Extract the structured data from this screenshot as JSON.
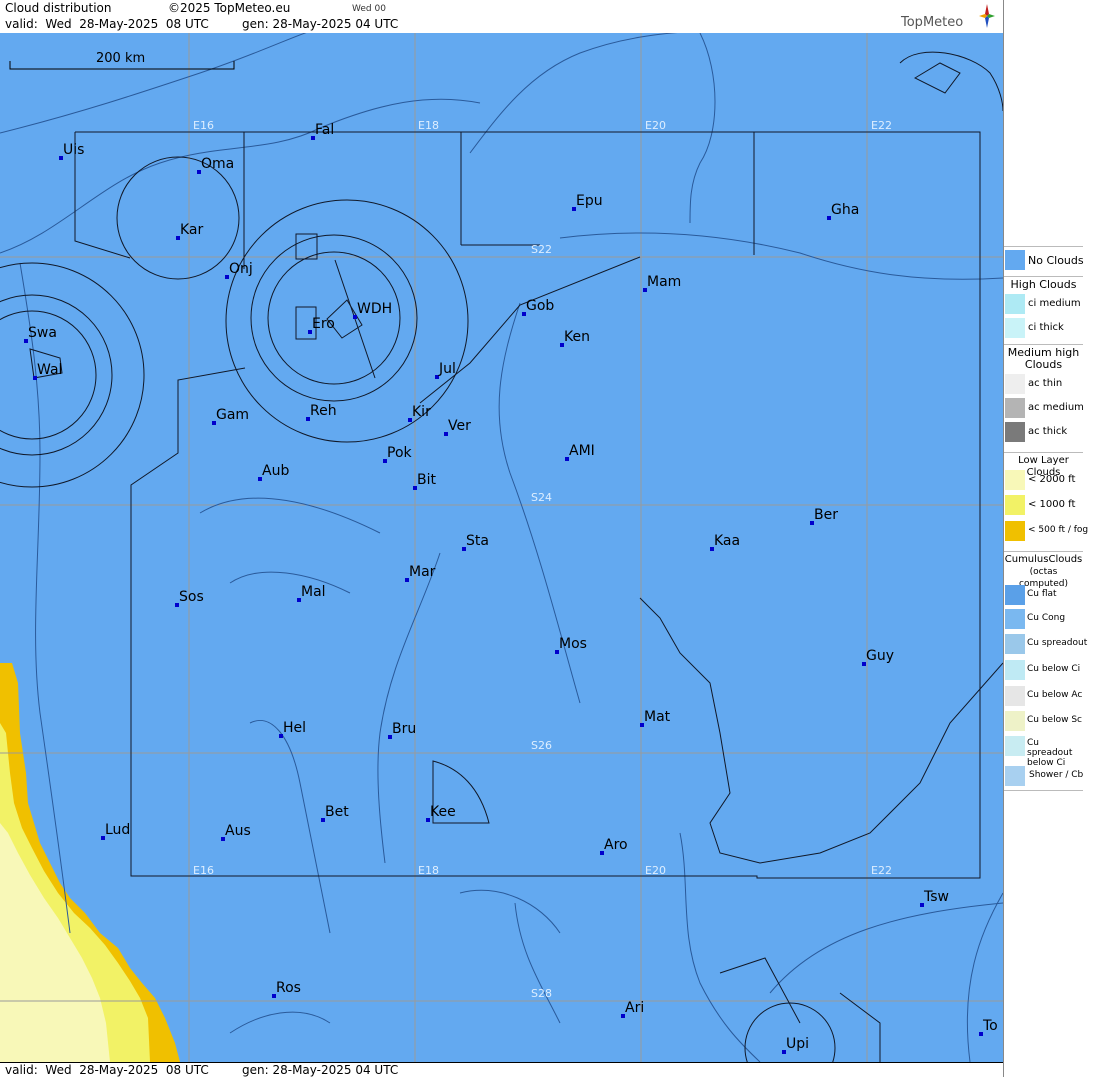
{
  "header": {
    "title": "Cloud distribution",
    "copyright": "©2025 TopMeteo.eu",
    "run": "Wed 00",
    "valid": "valid:  Wed  28-May-2025  08 UTC",
    "gen": "gen: 28-May-2025 04 UTC",
    "logo": "TopMeteo"
  },
  "footer": {
    "valid": "valid:  Wed  28-May-2025  08 UTC",
    "gen": "gen: 28-May-2025 04 UTC"
  },
  "map": {
    "scale_label": "200 km",
    "grid_labels": {
      "top": [
        "E16",
        "E18",
        "E20",
        "E22"
      ],
      "bottom": [
        "E16",
        "E18",
        "E20",
        "E22"
      ],
      "lat": [
        "S22",
        "S24",
        "S26",
        "S28"
      ]
    },
    "towns": [
      {
        "name": "Uis"
      },
      {
        "name": "Fal"
      },
      {
        "name": "Oma"
      },
      {
        "name": "Kar"
      },
      {
        "name": "Epu"
      },
      {
        "name": "Gha"
      },
      {
        "name": "Onj"
      },
      {
        "name": "Mam"
      },
      {
        "name": "Gob"
      },
      {
        "name": "WDH"
      },
      {
        "name": "Swa"
      },
      {
        "name": "Ero"
      },
      {
        "name": "Ken"
      },
      {
        "name": "Wal"
      },
      {
        "name": "Jul"
      },
      {
        "name": "Gam"
      },
      {
        "name": "Reh"
      },
      {
        "name": "Kir"
      },
      {
        "name": "Ver"
      },
      {
        "name": "AMI"
      },
      {
        "name": "Pok"
      },
      {
        "name": "Aub"
      },
      {
        "name": "Bit"
      },
      {
        "name": "Ber"
      },
      {
        "name": "Sta"
      },
      {
        "name": "Kaa"
      },
      {
        "name": "Mar"
      },
      {
        "name": "Sos"
      },
      {
        "name": "Mal"
      },
      {
        "name": "Mos"
      },
      {
        "name": "Guy"
      },
      {
        "name": "Mat"
      },
      {
        "name": "Hel"
      },
      {
        "name": "Bru"
      },
      {
        "name": "Bet"
      },
      {
        "name": "Kee"
      },
      {
        "name": "Lud"
      },
      {
        "name": "Aus"
      },
      {
        "name": "Aro"
      },
      {
        "name": "Tsw"
      },
      {
        "name": "Ros"
      },
      {
        "name": "Ari"
      },
      {
        "name": "To"
      },
      {
        "name": "Upi"
      }
    ],
    "colors": {
      "sea_land": "#63a9f0",
      "lines": "#1c3c66",
      "fog": "#f0c000",
      "low1000": "#f2f266",
      "low2000": "#f8f8b8"
    }
  },
  "legend": {
    "no_clouds": "No Clouds",
    "high_title": "High Clouds",
    "high": [
      "ci medium",
      "ci thick"
    ],
    "medium_title": "Medium high Clouds",
    "medium": [
      "ac thin",
      "ac medium",
      "ac thick"
    ],
    "low_title": "Low Layer Clouds",
    "low": [
      "< 2000 ft",
      "< 1000 ft",
      "< 500 ft / fog"
    ],
    "cu_title": "CumulusClouds",
    "cu_subtitle": "(octas computed)",
    "cu": [
      "Cu flat",
      "Cu Cong",
      "Cu spreadout",
      "Cu below Ci",
      "Cu below Ac",
      "Cu below Sc",
      "Cu spreadout below Ci",
      "Shower / Cb"
    ]
  }
}
